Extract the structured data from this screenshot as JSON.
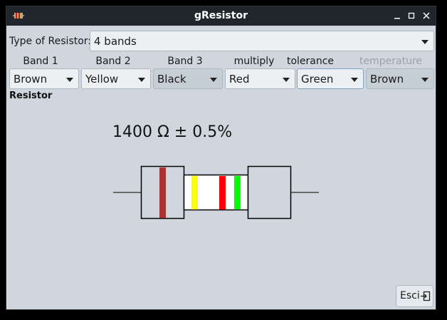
{
  "window": {
    "title": "gResistor",
    "controls": [
      "minimize-icon",
      "maximize-icon",
      "close-icon"
    ]
  },
  "type_row": {
    "label": "Type of  Resistor:",
    "selected": "4 bands"
  },
  "bands": [
    {
      "header": "Band 1",
      "value": "Brown",
      "enabled": true
    },
    {
      "header": "Band 2",
      "value": "Yellow",
      "enabled": true
    },
    {
      "header": "Band 3",
      "value": "Black",
      "enabled": true
    },
    {
      "header": "multiply",
      "value": "Red",
      "enabled": true
    },
    {
      "header": "tolerance",
      "value": "Green",
      "enabled": true
    },
    {
      "header": "temperature",
      "value": "Brown",
      "enabled": false
    }
  ],
  "section_title": "Resistor",
  "result_text": "1400 Ω ± 0.5%",
  "resistor_stripe_colors": [
    "#a93232",
    "#ffff00",
    "#ff0000",
    "#00ff00"
  ],
  "buttons": {
    "exit_label": "Esci"
  },
  "colors": {
    "window_bg": "#cfd6dd",
    "titlebar_bg": "#21262d"
  }
}
